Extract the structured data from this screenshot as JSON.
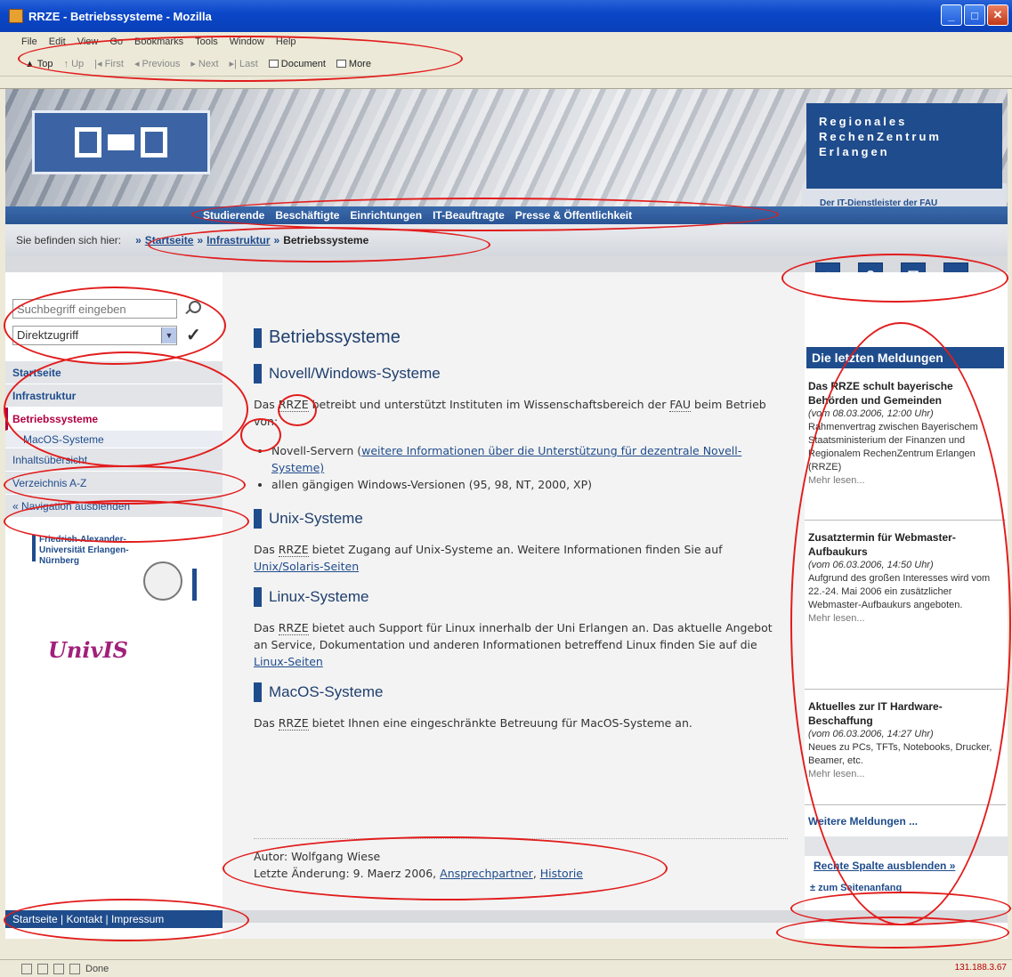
{
  "window": {
    "title": "RRZE - Betriebssysteme - Mozilla",
    "min": "_",
    "max": "□",
    "close": "✕"
  },
  "menubar": [
    "File",
    "Edit",
    "View",
    "Go",
    "Bookmarks",
    "Tools",
    "Window",
    "Help"
  ],
  "toolbar": {
    "items": [
      "Top",
      "Up",
      "First",
      "Previous",
      "Next",
      "Last"
    ],
    "document": "Document",
    "more": "More"
  },
  "header": {
    "brand": [
      "Regionales",
      "RechenZentrum",
      "Erlangen"
    ],
    "tagline": "Der IT-Dienstleister der FAU"
  },
  "topnav": [
    "Studierende",
    "Beschäftigte",
    "Einrichtungen",
    "IT-Beauftragte",
    "Presse & Öffentlichkeit"
  ],
  "breadcrumb": {
    "lead": "Sie befinden sich hier:",
    "sep": "»",
    "links": [
      "Startseite",
      "Infrastruktur"
    ],
    "current": "Betriebssysteme"
  },
  "tool_icons": [
    "⌂",
    "?",
    "✉",
    "⌕"
  ],
  "search": {
    "placeholder": "Suchbegriff eingeben",
    "direct": "Direktzugriff"
  },
  "leftnav": {
    "startseite": "Startseite",
    "infrastruktur": "Infrastruktur",
    "betriebssysteme": "Betriebssysteme",
    "macos": "MacOS-Systeme",
    "inhalt": "Inhaltsübersicht",
    "verzeichnis": "Verzeichnis A-Z",
    "hide": "« Navigation ausblenden"
  },
  "university": {
    "name": "Friedrich-Alexander-Universität Erlangen-Nürnberg"
  },
  "univis": "UnivIS",
  "left_footer": "Startseite | Kontakt | Impressum",
  "main": {
    "title": "Betriebssysteme",
    "s1": {
      "heading": "Novell/Windows-Systeme",
      "p_a": "Das ",
      "rrze": "RRZE",
      "p_b": " betreibt und unterstützt Instituten im Wissenschaftsbereich der ",
      "fau": "FAU",
      "p_c": " beim Betrieb von:",
      "li1_a": "Novell-Servern (",
      "li1_link": "weitere Informationen über die Unterstützung für dezentrale Novell-Systeme)",
      "li2": "allen gängigen Windows-Versionen (95, 98, NT, 2000, XP)"
    },
    "s2": {
      "heading": "Unix-Systeme",
      "p_a": "Das ",
      "rrze": "RRZE",
      "p_b": " bietet Zugang auf Unix-Systeme an. Weitere Informationen finden Sie auf ",
      "link": "Unix/Solaris-Seiten"
    },
    "s3": {
      "heading": "Linux-Systeme",
      "p_a": "Das ",
      "rrze": "RRZE",
      "p_b": " bietet auch Support für Linux innerhalb der Uni Erlangen an. Das aktuelle Angebot an Service, Dokumentation und anderen Informationen betreffend Linux finden Sie auf die ",
      "link": "Linux-Seiten"
    },
    "s4": {
      "heading": "MacOS-Systeme",
      "p_a": "Das ",
      "rrze": "RRZE",
      "p_b": " bietet Ihnen eine eingeschränkte Betreuung für MacOS-Systeme an."
    },
    "author": "Autor: Wolfgang Wiese",
    "changed": "Letzte Änderung: 9. Maerz 2006, ",
    "contact": "Ansprechpartner",
    "history": "Historie"
  },
  "right": {
    "heading": "Die letzten Meldungen",
    "news": [
      {
        "title": "Das RRZE schult bayerische Behörden und Gemeinden",
        "date": "(vom 08.03.2006, 12:00 Uhr)",
        "text": "Rahmenvertrag zwischen Bayerischem Staatsministerium der Finanzen und Regionalem RechenZentrum Erlangen (RRZE)",
        "more": "Mehr lesen..."
      },
      {
        "title": "Zusatztermin für Webmaster-Aufbaukurs",
        "date": "(vom 06.03.2006, 14:50 Uhr)",
        "text": "Aufgrund des großen Interesses wird vom 22.-24. Mai 2006 ein zusätzlicher Webmaster-Aufbaukurs angeboten.",
        "more": "Mehr lesen..."
      },
      {
        "title": "Aktuelles zur IT Hardware-Beschaffung",
        "date": "(vom 06.03.2006, 14:27 Uhr)",
        "text": "Neues zu PCs, TFTs, Notebooks, Drucker, Beamer, etc.",
        "more": "Mehr lesen..."
      }
    ],
    "more_news": "Weitere Meldungen ...",
    "hide": "Rechte Spalte ausblenden »",
    "top": "± zum Seitenanfang"
  },
  "statusbar": {
    "text": "Done",
    "ip": "131.188.3.67"
  },
  "colors": {
    "brand": "#1f4c8c",
    "active": "#b00040",
    "annotation": "#e21c1c"
  }
}
